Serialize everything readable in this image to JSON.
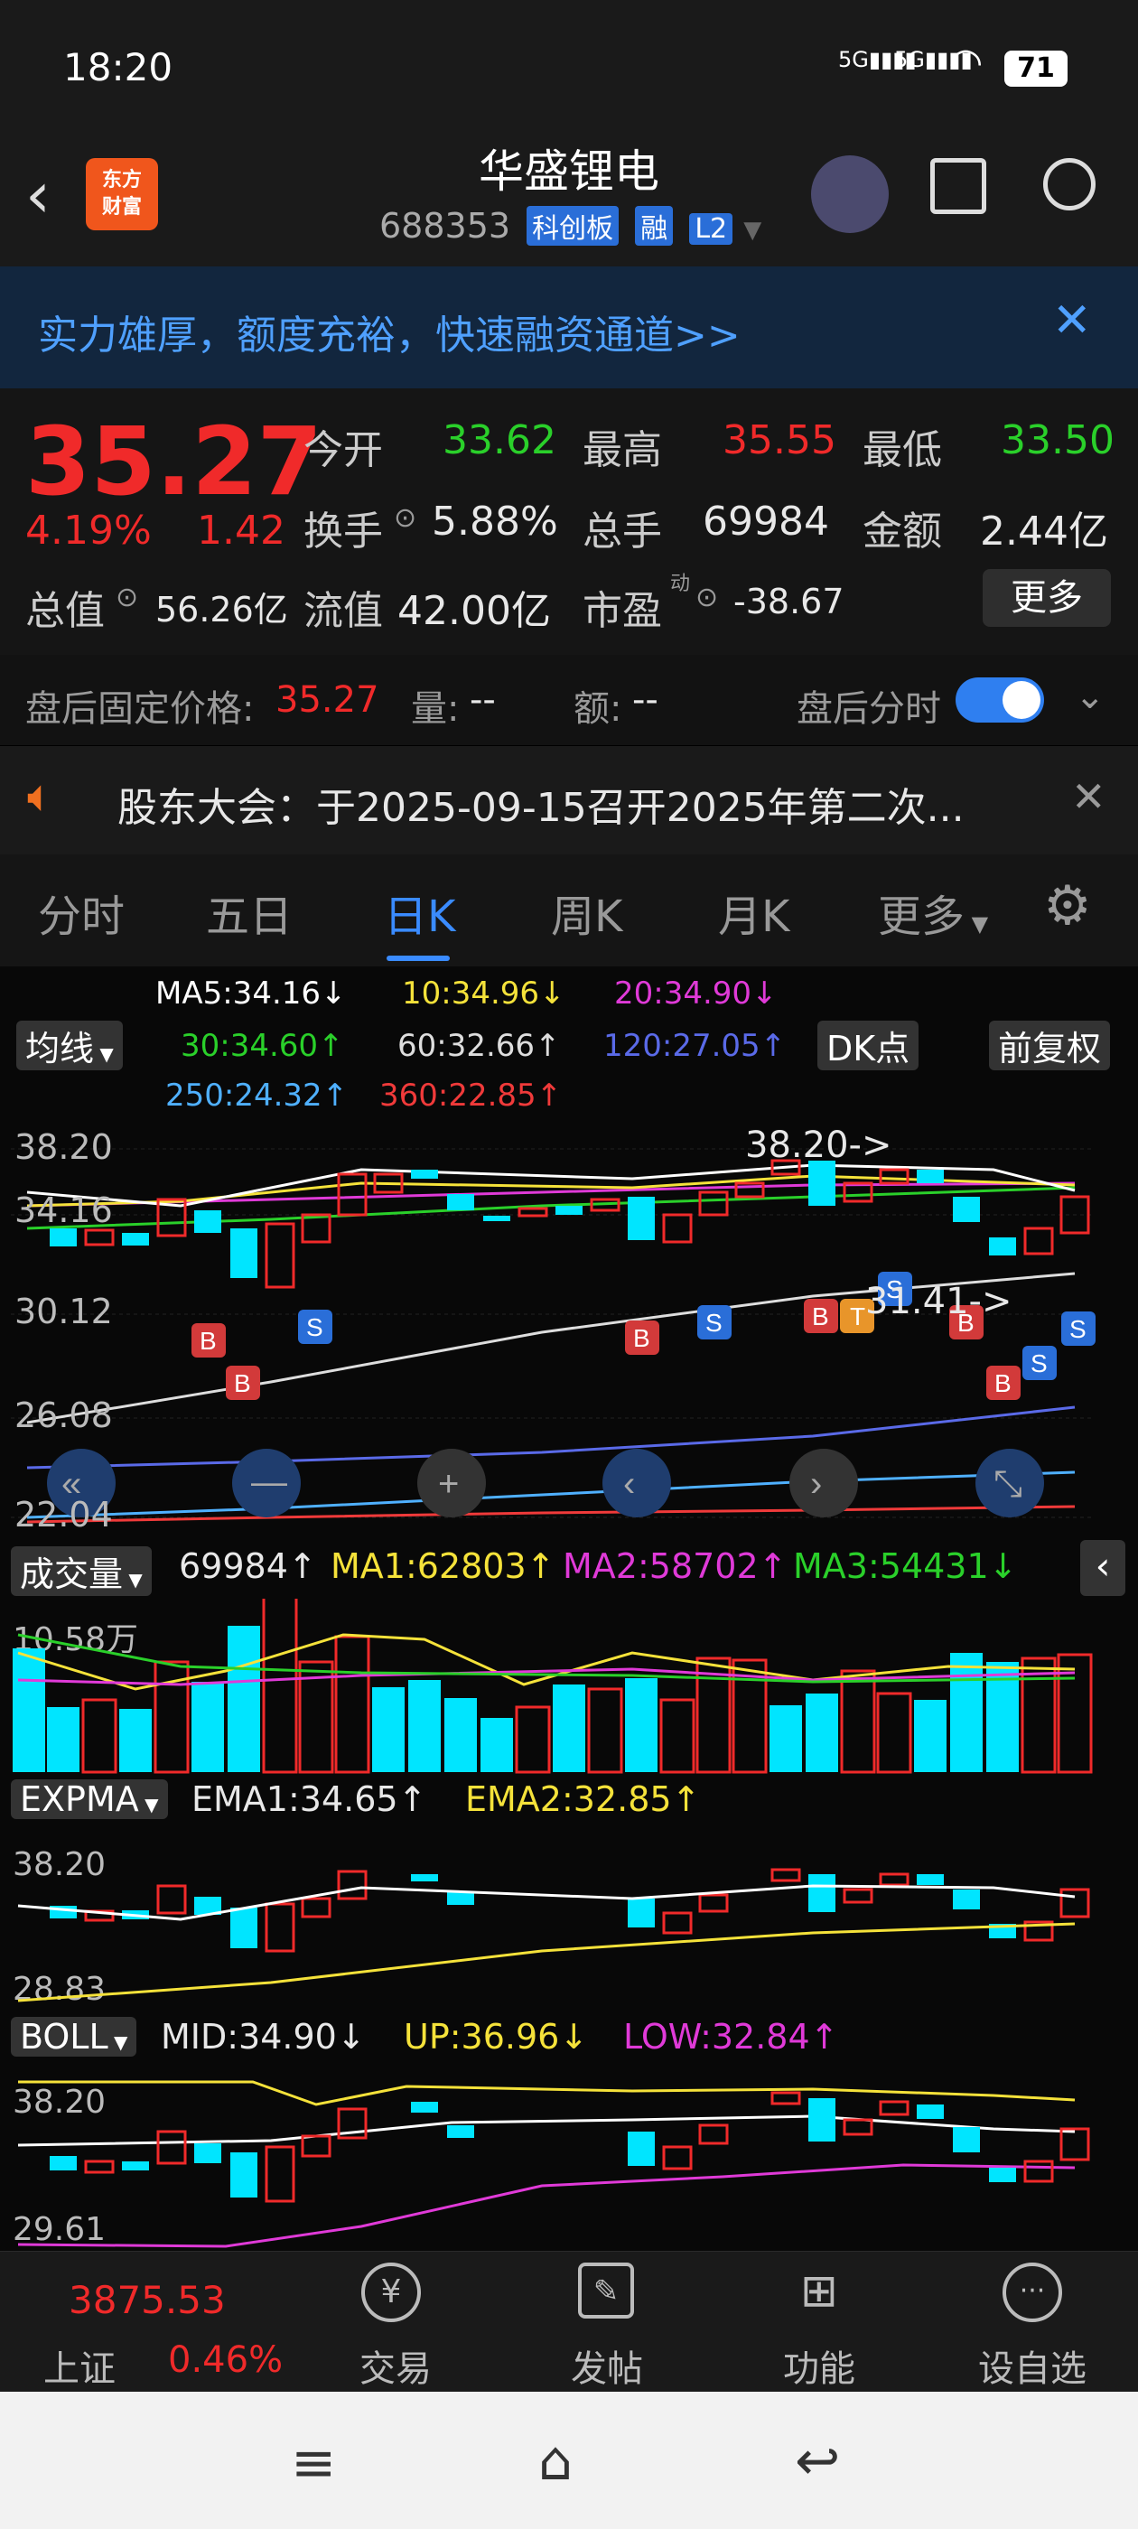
{
  "status_bar": {
    "time": "18:20",
    "battery": "71",
    "signal1": "5G",
    "signal2": "5G"
  },
  "header": {
    "logo_line1": "东方",
    "logo_line2": "财富",
    "name": "华盛锂电",
    "code": "688353",
    "badges": [
      "科创板",
      "融",
      "L2"
    ]
  },
  "banner": {
    "text": "实力雄厚，额度充裕，快速融资通道>>"
  },
  "quote": {
    "price": "35.27",
    "change_pct": "4.19%",
    "change": "1.42",
    "open_label": "今开",
    "open": "33.62",
    "high_label": "最高",
    "high": "35.55",
    "low_label": "最低",
    "low": "33.50",
    "turnover_label": "换手",
    "turnover": "5.88%",
    "volume_label": "总手",
    "volume": "69984",
    "amount_label": "金额",
    "amount": "2.44亿",
    "mktcap_label": "总值",
    "mktcap": "56.26亿",
    "float_label": "流值",
    "float": "42.00亿",
    "pe_label": "市盈",
    "pe_sup": "动",
    "pe": "-38.67",
    "more": "更多"
  },
  "after_hours": {
    "price_label": "盘后固定价格:",
    "price": "35.27",
    "vol_label": "量:",
    "vol": "--",
    "amt_label": "额:",
    "amt": "--",
    "toggle_label": "盘后分时"
  },
  "notice": {
    "text": "股东大会：于2025-09-15召开2025年第二次..."
  },
  "tabs": [
    "分时",
    "五日",
    "日K",
    "周K",
    "月K",
    "更多"
  ],
  "ma": {
    "ma5": "MA5:34.16",
    "ma10": "10:34.96",
    "ma20": "20:34.90",
    "ma30": "30:34.60",
    "ma60": "60:32.66",
    "ma120": "120:27.05",
    "ma250": "250:24.32",
    "ma360": "360:22.85",
    "btn_line": "均线",
    "btn_dk": "DK点",
    "btn_adj": "前复权"
  },
  "kline": {
    "y_labels": [
      "38.20",
      "34.16",
      "30.12",
      "26.08",
      "22.04"
    ],
    "high_marker": "38.20->",
    "low_marker": "31.41->"
  },
  "volume_panel": {
    "name": "成交量",
    "value": "69984",
    "ma1": "MA1:62803",
    "ma2": "MA2:58702",
    "ma3": "MA3:54431",
    "y_top": "10.58万"
  },
  "expma_panel": {
    "name": "EXPMA",
    "ema1": "EMA1:34.65",
    "ema2": "EMA2:32.85",
    "y_top": "38.20",
    "y_bottom": "28.83"
  },
  "boll_panel": {
    "name": "BOLL",
    "mid": "MID:34.90",
    "up": "UP:36.96",
    "low": "LOW:32.84",
    "y_top": "38.20",
    "y_bottom": "29.61"
  },
  "index": {
    "value": "3875.53",
    "name": "上证",
    "pct": "0.46%"
  },
  "bottom_nav": {
    "trade": "交易",
    "post": "发帖",
    "func": "功能",
    "watch": "设自选"
  },
  "colors": {
    "up": "#f02a2a",
    "down": "#00e5ff",
    "accent": "#3a8bff"
  }
}
